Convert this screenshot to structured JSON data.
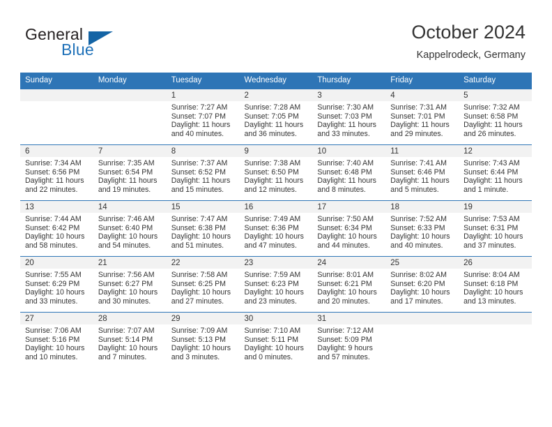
{
  "brand": {
    "name_part1": "General",
    "name_part2": "Blue",
    "logo_icon": "triangle-logo-icon"
  },
  "header": {
    "title": "October 2024",
    "location": "Kappelrodeck, Germany"
  },
  "calendar": {
    "weekday_headers": [
      "Sunday",
      "Monday",
      "Tuesday",
      "Wednesday",
      "Thursday",
      "Friday",
      "Saturday"
    ],
    "header_bg": "#2e75b6",
    "daynum_bg": "#f2f2f2",
    "grid_line": "#2e75b6",
    "weeks": [
      [
        {
          "day": "",
          "lines": []
        },
        {
          "day": "",
          "lines": []
        },
        {
          "day": "1",
          "lines": [
            "Sunrise: 7:27 AM",
            "Sunset: 7:07 PM",
            "Daylight: 11 hours",
            "and 40 minutes."
          ]
        },
        {
          "day": "2",
          "lines": [
            "Sunrise: 7:28 AM",
            "Sunset: 7:05 PM",
            "Daylight: 11 hours",
            "and 36 minutes."
          ]
        },
        {
          "day": "3",
          "lines": [
            "Sunrise: 7:30 AM",
            "Sunset: 7:03 PM",
            "Daylight: 11 hours",
            "and 33 minutes."
          ]
        },
        {
          "day": "4",
          "lines": [
            "Sunrise: 7:31 AM",
            "Sunset: 7:01 PM",
            "Daylight: 11 hours",
            "and 29 minutes."
          ]
        },
        {
          "day": "5",
          "lines": [
            "Sunrise: 7:32 AM",
            "Sunset: 6:58 PM",
            "Daylight: 11 hours",
            "and 26 minutes."
          ]
        }
      ],
      [
        {
          "day": "6",
          "lines": [
            "Sunrise: 7:34 AM",
            "Sunset: 6:56 PM",
            "Daylight: 11 hours",
            "and 22 minutes."
          ]
        },
        {
          "day": "7",
          "lines": [
            "Sunrise: 7:35 AM",
            "Sunset: 6:54 PM",
            "Daylight: 11 hours",
            "and 19 minutes."
          ]
        },
        {
          "day": "8",
          "lines": [
            "Sunrise: 7:37 AM",
            "Sunset: 6:52 PM",
            "Daylight: 11 hours",
            "and 15 minutes."
          ]
        },
        {
          "day": "9",
          "lines": [
            "Sunrise: 7:38 AM",
            "Sunset: 6:50 PM",
            "Daylight: 11 hours",
            "and 12 minutes."
          ]
        },
        {
          "day": "10",
          "lines": [
            "Sunrise: 7:40 AM",
            "Sunset: 6:48 PM",
            "Daylight: 11 hours",
            "and 8 minutes."
          ]
        },
        {
          "day": "11",
          "lines": [
            "Sunrise: 7:41 AM",
            "Sunset: 6:46 PM",
            "Daylight: 11 hours",
            "and 5 minutes."
          ]
        },
        {
          "day": "12",
          "lines": [
            "Sunrise: 7:43 AM",
            "Sunset: 6:44 PM",
            "Daylight: 11 hours",
            "and 1 minute."
          ]
        }
      ],
      [
        {
          "day": "13",
          "lines": [
            "Sunrise: 7:44 AM",
            "Sunset: 6:42 PM",
            "Daylight: 10 hours",
            "and 58 minutes."
          ]
        },
        {
          "day": "14",
          "lines": [
            "Sunrise: 7:46 AM",
            "Sunset: 6:40 PM",
            "Daylight: 10 hours",
            "and 54 minutes."
          ]
        },
        {
          "day": "15",
          "lines": [
            "Sunrise: 7:47 AM",
            "Sunset: 6:38 PM",
            "Daylight: 10 hours",
            "and 51 minutes."
          ]
        },
        {
          "day": "16",
          "lines": [
            "Sunrise: 7:49 AM",
            "Sunset: 6:36 PM",
            "Daylight: 10 hours",
            "and 47 minutes."
          ]
        },
        {
          "day": "17",
          "lines": [
            "Sunrise: 7:50 AM",
            "Sunset: 6:34 PM",
            "Daylight: 10 hours",
            "and 44 minutes."
          ]
        },
        {
          "day": "18",
          "lines": [
            "Sunrise: 7:52 AM",
            "Sunset: 6:33 PM",
            "Daylight: 10 hours",
            "and 40 minutes."
          ]
        },
        {
          "day": "19",
          "lines": [
            "Sunrise: 7:53 AM",
            "Sunset: 6:31 PM",
            "Daylight: 10 hours",
            "and 37 minutes."
          ]
        }
      ],
      [
        {
          "day": "20",
          "lines": [
            "Sunrise: 7:55 AM",
            "Sunset: 6:29 PM",
            "Daylight: 10 hours",
            "and 33 minutes."
          ]
        },
        {
          "day": "21",
          "lines": [
            "Sunrise: 7:56 AM",
            "Sunset: 6:27 PM",
            "Daylight: 10 hours",
            "and 30 minutes."
          ]
        },
        {
          "day": "22",
          "lines": [
            "Sunrise: 7:58 AM",
            "Sunset: 6:25 PM",
            "Daylight: 10 hours",
            "and 27 minutes."
          ]
        },
        {
          "day": "23",
          "lines": [
            "Sunrise: 7:59 AM",
            "Sunset: 6:23 PM",
            "Daylight: 10 hours",
            "and 23 minutes."
          ]
        },
        {
          "day": "24",
          "lines": [
            "Sunrise: 8:01 AM",
            "Sunset: 6:21 PM",
            "Daylight: 10 hours",
            "and 20 minutes."
          ]
        },
        {
          "day": "25",
          "lines": [
            "Sunrise: 8:02 AM",
            "Sunset: 6:20 PM",
            "Daylight: 10 hours",
            "and 17 minutes."
          ]
        },
        {
          "day": "26",
          "lines": [
            "Sunrise: 8:04 AM",
            "Sunset: 6:18 PM",
            "Daylight: 10 hours",
            "and 13 minutes."
          ]
        }
      ],
      [
        {
          "day": "27",
          "lines": [
            "Sunrise: 7:06 AM",
            "Sunset: 5:16 PM",
            "Daylight: 10 hours",
            "and 10 minutes."
          ]
        },
        {
          "day": "28",
          "lines": [
            "Sunrise: 7:07 AM",
            "Sunset: 5:14 PM",
            "Daylight: 10 hours",
            "and 7 minutes."
          ]
        },
        {
          "day": "29",
          "lines": [
            "Sunrise: 7:09 AM",
            "Sunset: 5:13 PM",
            "Daylight: 10 hours",
            "and 3 minutes."
          ]
        },
        {
          "day": "30",
          "lines": [
            "Sunrise: 7:10 AM",
            "Sunset: 5:11 PM",
            "Daylight: 10 hours",
            "and 0 minutes."
          ]
        },
        {
          "day": "31",
          "lines": [
            "Sunrise: 7:12 AM",
            "Sunset: 5:09 PM",
            "Daylight: 9 hours",
            "and 57 minutes."
          ]
        },
        {
          "day": "",
          "lines": []
        },
        {
          "day": "",
          "lines": []
        }
      ]
    ]
  }
}
